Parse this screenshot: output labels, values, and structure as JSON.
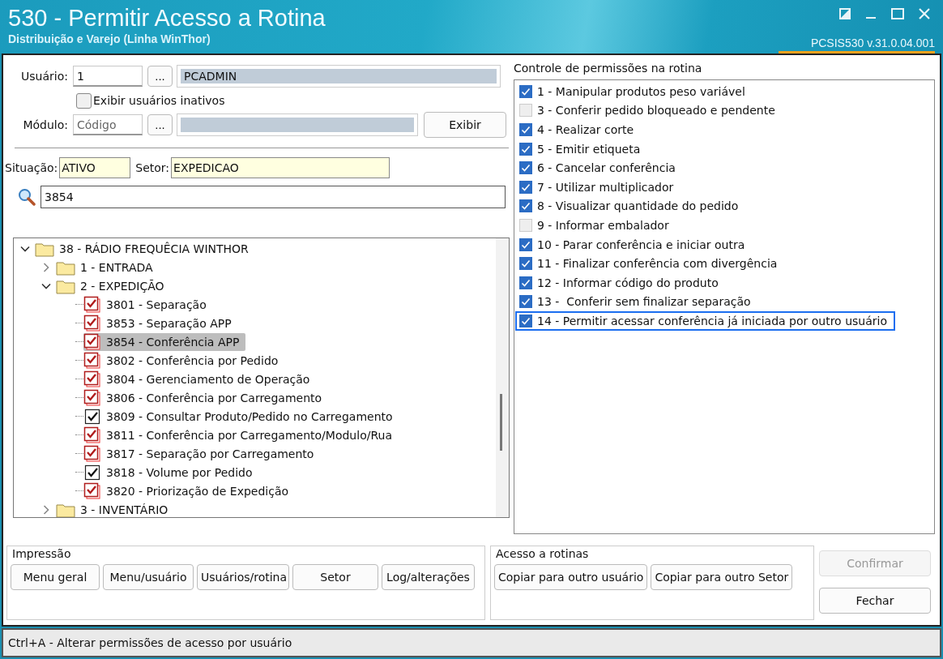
{
  "window": {
    "title": "530 - Permitir Acesso a Rotina",
    "subtitle": "Distribuição e Varejo (Linha WinThor)",
    "version": "PCSIS530  v.31.0.04.001"
  },
  "user": {
    "label": "Usuário:",
    "code": "1",
    "lookup": "...",
    "name": "PCADMIN"
  },
  "show_inactive": {
    "label": "Exibir usuários inativos",
    "checked": false
  },
  "module": {
    "label": "Módulo:",
    "placeholder": "Código",
    "lookup": "...",
    "button": "Exibir"
  },
  "situacao": {
    "label": "Situação:",
    "value": "ATIVO"
  },
  "setor": {
    "label": "Setor:",
    "value": "EXPEDICAO"
  },
  "search": {
    "value": "3854"
  },
  "tree": [
    {
      "label": "38 - RÁDIO FREQUÊCIA WINTHOR",
      "expanded": true,
      "children": [
        {
          "label": "1 - ENTRADA",
          "expanded": false
        },
        {
          "label": "2 - EXPEDIÇÃO",
          "expanded": true,
          "children": [
            {
              "label": "3801 - Separação",
              "kind": "stacked",
              "checked": true,
              "selected": false
            },
            {
              "label": "3853 - Separação APP",
              "kind": "stacked",
              "checked": true,
              "selected": false
            },
            {
              "label": "3854 - Conferência APP",
              "kind": "stacked",
              "checked": true,
              "selected": true
            },
            {
              "label": "3802 - Conferência por Pedido",
              "kind": "stacked",
              "checked": true,
              "selected": false
            },
            {
              "label": "3804 - Gerenciamento de Operação",
              "kind": "stacked",
              "checked": true,
              "selected": false
            },
            {
              "label": "3806 - Conferência por Carregamento",
              "kind": "stacked",
              "checked": true,
              "selected": false
            },
            {
              "label": "3809 - Consultar Produto/Pedido no Carregamento",
              "kind": "plain",
              "checked": true,
              "selected": false
            },
            {
              "label": "3811 - Conferência por Carregamento/Modulo/Rua",
              "kind": "stacked",
              "checked": true,
              "selected": false
            },
            {
              "label": "3817 - Separação por Carregamento",
              "kind": "stacked",
              "checked": true,
              "selected": false
            },
            {
              "label": "3818 - Volume por Pedido",
              "kind": "plain",
              "checked": true,
              "selected": false
            },
            {
              "label": "3820 - Priorização de Expedição",
              "kind": "stacked",
              "checked": true,
              "selected": false
            }
          ]
        },
        {
          "label": "3 - INVENTÁRIO",
          "expanded": false
        }
      ]
    }
  ],
  "permissions": {
    "title": "Controle de permissões na rotina",
    "items": [
      {
        "label": "1 - Manipular produtos peso variável",
        "checked": true,
        "selected": false
      },
      {
        "label": "3 - Conferir pedido bloqueado e pendente",
        "checked": false,
        "selected": false
      },
      {
        "label": "4 - Realizar corte",
        "checked": true,
        "selected": false
      },
      {
        "label": "5 - Emitir etiqueta",
        "checked": true,
        "selected": false
      },
      {
        "label": "6 - Cancelar conferência",
        "checked": true,
        "selected": false
      },
      {
        "label": "7 - Utilizar multiplicador",
        "checked": true,
        "selected": false
      },
      {
        "label": "8 - Visualizar quantidade do pedido",
        "checked": true,
        "selected": false
      },
      {
        "label": "9 - Informar embalador",
        "checked": false,
        "selected": false
      },
      {
        "label": "10 - Parar conferência e iniciar outra",
        "checked": true,
        "selected": false
      },
      {
        "label": "11 - Finalizar conferência com divergência",
        "checked": true,
        "selected": false
      },
      {
        "label": "12 - Informar código do produto",
        "checked": true,
        "selected": false
      },
      {
        "label": "13 -  Conferir sem finalizar separação",
        "checked": true,
        "selected": false
      },
      {
        "label": "14 - Permitir acessar conferência já iniciada por outro usuário",
        "checked": true,
        "selected": true
      }
    ]
  },
  "impressao": {
    "title": "Impressão",
    "buttons": [
      "Menu geral",
      "Menu/usuário",
      "Usuários/rotina",
      "Setor",
      "Log/alterações"
    ]
  },
  "acesso": {
    "title": "Acesso a rotinas",
    "buttons": [
      "Copiar para outro usuário",
      "Copiar para outro Setor"
    ]
  },
  "actions": [
    {
      "label": "Confirmar",
      "disabled": true
    },
    {
      "label": "Fechar",
      "disabled": false
    }
  ],
  "status_bar": "Ctrl+A - Alterar permissões de acesso por usuário"
}
